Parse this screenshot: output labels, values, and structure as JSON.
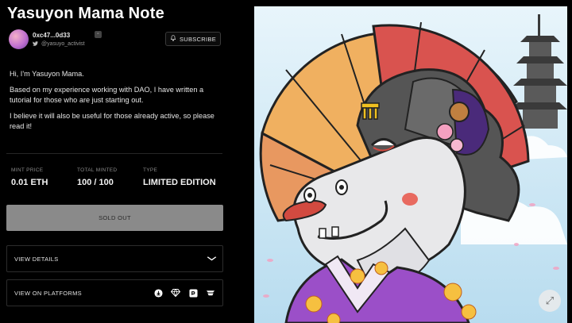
{
  "header": {
    "title": "Yasuyon Mama Note"
  },
  "creator": {
    "address": "0xc47...0d33",
    "handle": "@yasuyo_activist"
  },
  "subscribe": {
    "label": "SUBSCRIBE"
  },
  "description": {
    "paragraphs": [
      "Hi, I'm Yasuyon Mama.",
      "Based on my experience working with DAO, I have written a tutorial for those who are just starting out.",
      "I believe it will also be useful for those already active, so please read it!"
    ]
  },
  "stats": [
    {
      "label": "MINT PRICE",
      "value": "0.01 ETH"
    },
    {
      "label": "TOTAL MINTED",
      "value": "100 / 100"
    },
    {
      "label": "TYPE",
      "value": "LIMITED EDITION"
    }
  ],
  "mint_button": {
    "label": "SOLD OUT"
  },
  "details_row": {
    "label": "VIEW DETAILS"
  },
  "platforms_row": {
    "label": "VIEW ON PLATFORMS",
    "icons": [
      "download-icon",
      "gem-icon",
      "square-logo-icon",
      "boat-logo-icon"
    ]
  },
  "colors": {
    "background": "#000000",
    "soldout_bg": "#8a8a8a",
    "kimono": "#9b4fc8",
    "umbrella_red": "#d9534f",
    "umbrella_orange": "#f0b060",
    "sky": "#c9e6f4"
  }
}
